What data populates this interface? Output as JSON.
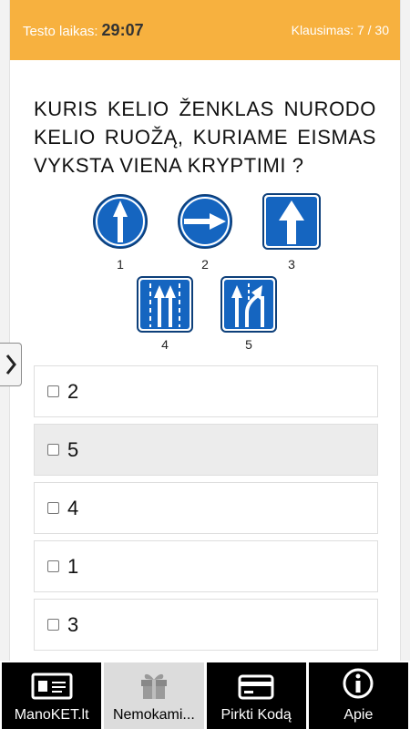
{
  "header": {
    "timer_label": "Testo laikas:",
    "timer_value": "29:07",
    "counter": "Klausimas: 7 / 30"
  },
  "question": {
    "text": "KURIS KELIO ŽENKLAS NURODO KELIO RUOŽĄ, KURIAME EISMAS VYKSTA VIENA KRYPTIMI ?"
  },
  "signs": [
    {
      "number": "1",
      "icon": "round-blue-arrow-up-icon"
    },
    {
      "number": "2",
      "icon": "round-blue-arrow-right-icon"
    },
    {
      "number": "3",
      "icon": "square-blue-one-way-icon"
    },
    {
      "number": "4",
      "icon": "square-blue-lanes-icon"
    },
    {
      "number": "5",
      "icon": "square-blue-lane-split-icon"
    }
  ],
  "options": [
    {
      "label": "2",
      "selected": false
    },
    {
      "label": "5",
      "selected": true
    },
    {
      "label": "4",
      "selected": false
    },
    {
      "label": "1",
      "selected": false
    },
    {
      "label": "3",
      "selected": false
    }
  ],
  "bottom_nav": [
    {
      "label": "ManoKET.lt",
      "icon": "id-card-icon",
      "active": false
    },
    {
      "label": "Nemokami...",
      "icon": "gift-icon",
      "active": true
    },
    {
      "label": "Pirkti Kodą",
      "icon": "credit-card-icon",
      "active": false
    },
    {
      "label": "Apie",
      "icon": "info-icon",
      "active": false
    }
  ],
  "colors": {
    "header": "#f7b13f",
    "sign_blue": "#1565c0",
    "nav_background": "#000000",
    "nav_active": "#dcdcdc"
  }
}
